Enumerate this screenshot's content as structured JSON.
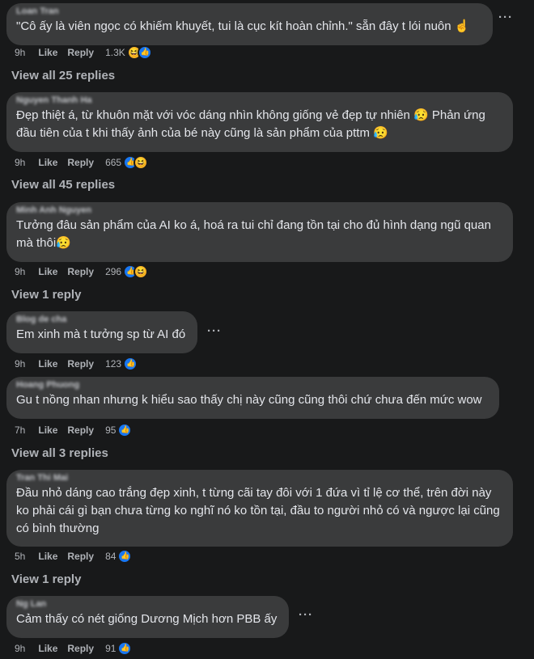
{
  "comments": [
    {
      "name": "Loan Tran",
      "text": "\"Cô ấy là viên ngọc có khiếm khuyết, tui là cục kít hoàn chỉnh.\" sẵn đây t lói nuôn ☝️",
      "time": "9h",
      "like": "Like",
      "reply": "Reply",
      "count": "1.3K"
    },
    {
      "name": "Nguyen Thanh Ha",
      "text": "Đẹp thiệt á, từ khuôn mặt với vóc dáng nhìn không giống vẻ đẹp tự nhiên 😥 Phản ứng đầu tiên của t khi thấy ảnh của bé này cũng là sản phẩm của pttm 😥",
      "time": "9h",
      "like": "Like",
      "reply": "Reply",
      "count": "665"
    },
    {
      "name": "Minh Anh Nguyen",
      "text": "Tưởng đâu sản phẩm của AI ko á, hoá ra tui chỉ đang tồn tại cho đủ hình dạng ngũ quan mà thôi😥",
      "time": "9h",
      "like": "Like",
      "reply": "Reply",
      "count": "296"
    },
    {
      "name": "Blog de cha",
      "text": "Em xinh mà t tưởng sp từ AI đó",
      "time": "9h",
      "like": "Like",
      "reply": "Reply",
      "count": "123"
    },
    {
      "name": "Hoang Phuong",
      "text": "Gu t nồng nhan nhưng k hiểu sao thấy chị này cũng cũng thôi chứ chưa đến mức wow",
      "time": "7h",
      "like": "Like",
      "reply": "Reply",
      "count": "95"
    },
    {
      "name": "Tran Thi Mai",
      "text": "Đầu nhỏ dáng cao trắng đẹp xinh, t từng cãi tay đôi với 1 đứa vì tỉ lệ cơ thể, trên đời này ko phải cái gì bạn chưa từng ko nghĩ nó ko tồn tại, đầu to người nhỏ có và ngược lại cũng có bình thường",
      "time": "5h",
      "like": "Like",
      "reply": "Reply",
      "count": "84"
    },
    {
      "name": "Ng Lan",
      "text": "Cảm thấy có nét giống Dương Mịch hơn PBB ấy",
      "time": "9h",
      "like": "Like",
      "reply": "Reply",
      "count": "91"
    }
  ],
  "view_replies": [
    "View all 25 replies",
    "View all 45 replies",
    "View 1 reply",
    "View all 3 replies",
    "View 1 reply"
  ],
  "more_label": "···"
}
